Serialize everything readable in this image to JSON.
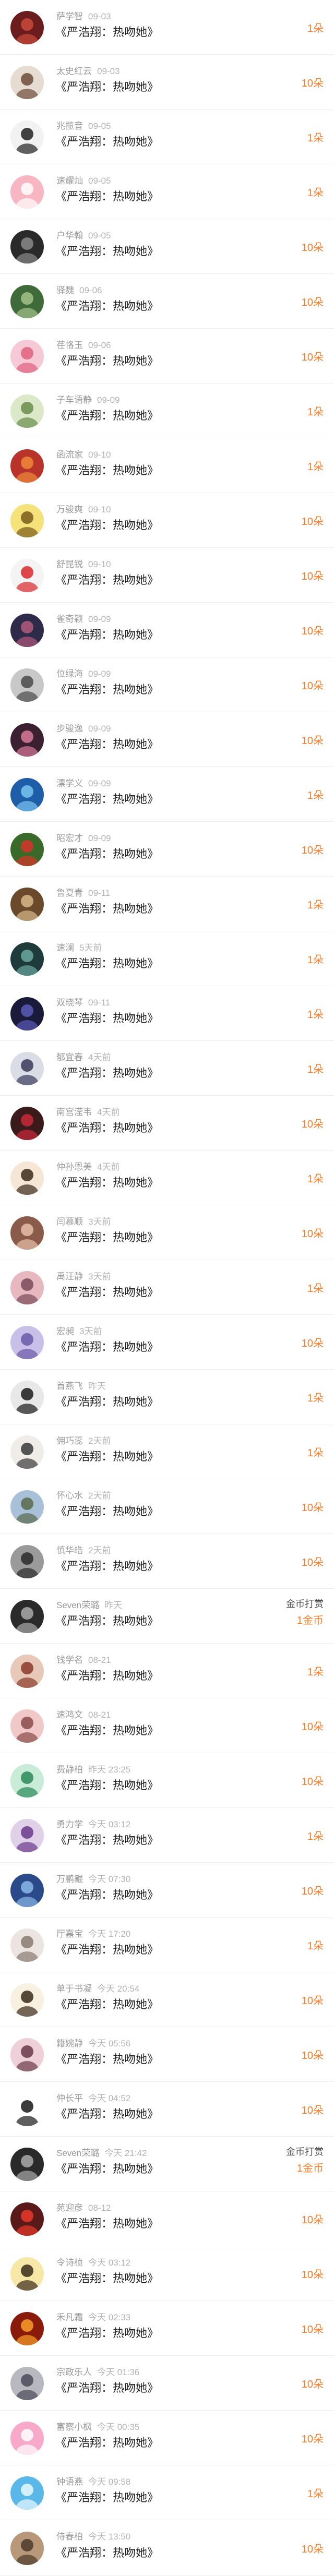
{
  "gift_title": "《严浩翔：热吻她》",
  "colors": {
    "accent_orange": "#ff7a24",
    "text_primary": "#222222",
    "text_secondary": "#9a9a9a",
    "divider": "#eeeeee"
  },
  "records": [
    {
      "name": "萨学智",
      "time": "09-03",
      "amount": "1朵",
      "avatar": "dark-red-avatar",
      "bg": "#6b1c1c",
      "fg": "#c94a3a"
    },
    {
      "name": "太史红云",
      "time": "09-03",
      "amount": "10朵",
      "avatar": "girl-photo-avatar",
      "bg": "#e6dcd2",
      "fg": "#6b4b3a"
    },
    {
      "name": "兆揽音",
      "time": "09-05",
      "amount": "1朵",
      "avatar": "cartoon-boy-avatar",
      "bg": "#f2f2f2",
      "fg": "#222222"
    },
    {
      "name": "速耀灿",
      "time": "09-05",
      "amount": "1朵",
      "avatar": "pink-logo-avatar",
      "bg": "#f7b6c2",
      "fg": "#ffffff"
    },
    {
      "name": "户华翰",
      "time": "09-05",
      "amount": "10朵",
      "avatar": "dark-portrait-avatar",
      "bg": "#2a2a2a",
      "fg": "#8a8a8a"
    },
    {
      "name": "驿魏",
      "time": "09-06",
      "amount": "10朵",
      "avatar": "green-scene-avatar",
      "bg": "#3f6b3a",
      "fg": "#a6c28a"
    },
    {
      "name": "荏恪玉",
      "time": "09-06",
      "amount": "10朵",
      "avatar": "pink-anime-avatar",
      "bg": "#f6c9d6",
      "fg": "#e0607e"
    },
    {
      "name": "子车语静",
      "time": "09-09",
      "amount": "1朵",
      "avatar": "green-girl-avatar",
      "bg": "#dbe9c9",
      "fg": "#6a8c4a"
    },
    {
      "name": "函流家",
      "time": "09-10",
      "amount": "1朵",
      "avatar": "red-orange-avatar",
      "bg": "#b8342a",
      "fg": "#f08a3a"
    },
    {
      "name": "万骏爽",
      "time": "09-10",
      "amount": "10朵",
      "avatar": "yellow-cartoon-avatar",
      "bg": "#f6e27a",
      "fg": "#7a5a1a"
    },
    {
      "name": "舒昆锐",
      "time": "09-10",
      "amount": "10朵",
      "avatar": "santa-cartoon-avatar",
      "bg": "#f4f4f4",
      "fg": "#d8282a"
    },
    {
      "name": "雀奇颖",
      "time": "09-09",
      "amount": "10朵",
      "avatar": "purple-dusk-avatar",
      "bg": "#2e2a4a",
      "fg": "#b05a7a"
    },
    {
      "name": "位绿海",
      "time": "09-09",
      "amount": "10朵",
      "avatar": "gray-portrait-avatar",
      "bg": "#c8c8c8",
      "fg": "#4a4a4a"
    },
    {
      "name": "步骏逸",
      "time": "09-09",
      "amount": "10朵",
      "avatar": "dark-pink-avatar",
      "bg": "#3a2030",
      "fg": "#d87a9a"
    },
    {
      "name": "漂学义",
      "time": "09-09",
      "amount": "1朵",
      "avatar": "blue-sparkle-avatar",
      "bg": "#1e5ea8",
      "fg": "#7ac4f2"
    },
    {
      "name": "昭宏才",
      "time": "09-09",
      "amount": "10朵",
      "avatar": "red-flower-avatar",
      "bg": "#3a6a2a",
      "fg": "#d8342a"
    },
    {
      "name": "鲁夏青",
      "time": "09-11",
      "amount": "1朵",
      "avatar": "brown-photo-avatar",
      "bg": "#6a4a2a",
      "fg": "#d8b88a"
    },
    {
      "name": "速澜",
      "time": "5天前",
      "amount": "1朵",
      "avatar": "teal-portrait-avatar",
      "bg": "#1e3a3a",
      "fg": "#6aa8a0"
    },
    {
      "name": "双晓琴",
      "time": "09-11",
      "amount": "1朵",
      "avatar": "night-sky-avatar",
      "bg": "#1a1a3a",
      "fg": "#5a5ab8"
    },
    {
      "name": "郁宜春",
      "time": "4天前",
      "amount": "1朵",
      "avatar": "gray-cartoon-avatar",
      "bg": "#dadde6",
      "fg": "#3a3a5a"
    },
    {
      "name": "南宫滢韦",
      "time": "4天前",
      "amount": "10朵",
      "avatar": "red-lips-avatar",
      "bg": "#3a1a1a",
      "fg": "#c82a3a"
    },
    {
      "name": "仲孙恩美",
      "time": "4天前",
      "amount": "1朵",
      "avatar": "chibi-girl-avatar",
      "bg": "#f6e6d6",
      "fg": "#3a2a1a"
    },
    {
      "name": "闫慕顺",
      "time": "3天前",
      "amount": "10朵",
      "avatar": "brown-girl-avatar",
      "bg": "#8a5a4a",
      "fg": "#e8c0a8"
    },
    {
      "name": "禹汪静",
      "time": "3天前",
      "amount": "1朵",
      "avatar": "pink-photo-avatar",
      "bg": "#e8b8c0",
      "fg": "#7a4a5a"
    },
    {
      "name": "宏昶",
      "time": "3天前",
      "amount": "10朵",
      "avatar": "lavender-avatar",
      "bg": "#c8c0e8",
      "fg": "#6a5aa8"
    },
    {
      "name": "首燕飞",
      "time": "昨天",
      "amount": "1朵",
      "avatar": "bw-portrait-avatar",
      "bg": "#e8e8e8",
      "fg": "#1a1a1a"
    },
    {
      "name": "佣巧蕊",
      "time": "2天前",
      "amount": "1朵",
      "avatar": "girl-white-avatar",
      "bg": "#f0ece8",
      "fg": "#3a3a3a"
    },
    {
      "name": "怀心水",
      "time": "2天前",
      "amount": "10朵",
      "avatar": "landscape-avatar",
      "bg": "#a8c0d8",
      "fg": "#5a6a4a"
    },
    {
      "name": "慎华皓",
      "time": "2天前",
      "amount": "10朵",
      "avatar": "gray-man-avatar",
      "bg": "#9a9a9a",
      "fg": "#2a2a2a"
    },
    {
      "name": "Seven荣璐",
      "time": "昨天",
      "amount": "1金币",
      "coin_label": "金币打赏",
      "avatar": "dark-man-avatar",
      "bg": "#2a2a2a",
      "fg": "#aaaaaa"
    },
    {
      "name": "钱学名",
      "time": "08-21",
      "amount": "1朵",
      "avatar": "anime-avatar",
      "bg": "#e8c8b8",
      "fg": "#8a3a2a"
    },
    {
      "name": "速鸿文",
      "time": "08-21",
      "amount": "10朵",
      "avatar": "pink-girl-avatar",
      "bg": "#f0c8c8",
      "fg": "#8a4a4a"
    },
    {
      "name": "费静柏",
      "time": "昨天 23:25",
      "amount": "10朵",
      "avatar": "mint-cartoon-avatar",
      "bg": "#c8ecd8",
      "fg": "#2a8a5a"
    },
    {
      "name": "勇力学",
      "time": "今天 03:12",
      "amount": "1朵",
      "avatar": "purple-hair-avatar",
      "bg": "#e0d0e8",
      "fg": "#6a3a8a"
    },
    {
      "name": "万鹏鲲",
      "time": "今天 07:30",
      "amount": "10朵",
      "avatar": "blue-scene-avatar",
      "bg": "#2a4a8a",
      "fg": "#8ab8e8"
    },
    {
      "name": "厅嘉宝",
      "time": "今天 17:20",
      "amount": "1朵",
      "avatar": "light-portrait-avatar",
      "bg": "#ece4e0",
      "fg": "#8a7a70"
    },
    {
      "name": "单于书凝",
      "time": "今天 20:54",
      "amount": "10朵",
      "avatar": "text-cartoon-avatar",
      "bg": "#f8f0e0",
      "fg": "#3a2a1a"
    },
    {
      "name": "籍婉静",
      "time": "今天 05:56",
      "amount": "10朵",
      "avatar": "pink-face-avatar",
      "bg": "#f0d0d8",
      "fg": "#6a3a4a"
    },
    {
      "name": "仲长平",
      "time": "今天 04:52",
      "amount": "10朵",
      "avatar": "sunglasses-avatar",
      "bg": "#ffffff",
      "fg": "#1a1a1a"
    },
    {
      "name": "Seven荣璐",
      "time": "今天 21:42",
      "amount": "1金币",
      "coin_label": "金币打赏",
      "avatar": "dark-man-avatar",
      "bg": "#2a2a2a",
      "fg": "#aaaaaa"
    },
    {
      "name": "苑迎彦",
      "time": "08-12",
      "amount": "10朵",
      "avatar": "red-orb-avatar",
      "bg": "#5a1a1a",
      "fg": "#e83a2a"
    },
    {
      "name": "令诗桢",
      "time": "今天 03:12",
      "amount": "10朵",
      "avatar": "yellow-bear-avatar",
      "bg": "#f8e8a8",
      "fg": "#3a2a1a"
    },
    {
      "name": "禾凡霜",
      "time": "今天 02:33",
      "amount": "10朵",
      "avatar": "fire-avatar",
      "bg": "#8a1a0a",
      "fg": "#f8a02a"
    },
    {
      "name": "宗政乐人",
      "time": "今天 01:36",
      "amount": "10朵",
      "avatar": "silver-portrait-avatar",
      "bg": "#b8b8c0",
      "fg": "#4a4a5a"
    },
    {
      "name": "富察小枫",
      "time": "今天 00:35",
      "amount": "10朵",
      "avatar": "pink-pig-avatar",
      "bg": "#f8a8c8",
      "fg": "#ffffff"
    },
    {
      "name": "钟语燕",
      "time": "今天 09:58",
      "amount": "1朵",
      "avatar": "sky-blue-avatar",
      "bg": "#5ab8e8",
      "fg": "#e8f8ff"
    },
    {
      "name": "侍春柏",
      "time": "今天 13:50",
      "amount": "10朵",
      "avatar": "photo-girl-avatar",
      "bg": "#b89878",
      "fg": "#4a3a2a"
    }
  ]
}
